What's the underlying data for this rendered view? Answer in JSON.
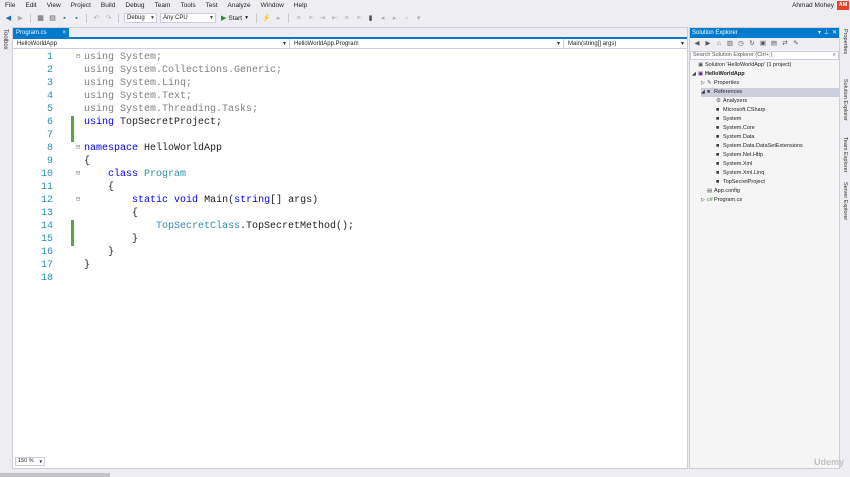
{
  "menu": {
    "items": [
      "File",
      "Edit",
      "View",
      "Project",
      "Build",
      "Debug",
      "Team",
      "Tools",
      "Test",
      "Analyze",
      "Window",
      "Help"
    ],
    "user_name": "Ahmad Mohey",
    "avatar_initials": "AM"
  },
  "toolbar": {
    "configuration": "Debug",
    "platform": "Any CPU",
    "start_label": "Start"
  },
  "toolbox": {
    "label": "Toolbox"
  },
  "editor": {
    "tab_label": "Program.cs",
    "tab_close": "×",
    "nav_project": "HelloWorldApp",
    "nav_type": "HelloWorldApp.Program",
    "nav_member": "Main(string[] args)",
    "zoom": "150 %",
    "line_numbers": [
      "1",
      "2",
      "3",
      "4",
      "5",
      "6",
      "7",
      "8",
      "9",
      "10",
      "11",
      "12",
      "13",
      "14",
      "15",
      "16",
      "17",
      "18"
    ],
    "lines": [
      {
        "indent": "",
        "parts": [
          [
            "kw-dim",
            "using"
          ],
          [
            "gray",
            " System;"
          ]
        ]
      },
      {
        "indent": "",
        "parts": [
          [
            "kw-dim",
            "using"
          ],
          [
            "gray",
            " System.Collections.Generic;"
          ]
        ]
      },
      {
        "indent": "",
        "parts": [
          [
            "kw-dim",
            "using"
          ],
          [
            "gray",
            " System.Linq;"
          ]
        ]
      },
      {
        "indent": "",
        "parts": [
          [
            "kw-dim",
            "using"
          ],
          [
            "gray",
            " System.Text;"
          ]
        ]
      },
      {
        "indent": "",
        "parts": [
          [
            "kw-dim",
            "using"
          ],
          [
            "gray",
            " System.Threading.Tasks;"
          ]
        ]
      },
      {
        "indent": "",
        "parts": [
          [
            "kw",
            "using"
          ],
          [
            "plain",
            " TopSecretProject;"
          ]
        ]
      },
      {
        "indent": "",
        "parts": []
      },
      {
        "indent": "",
        "parts": [
          [
            "kw",
            "namespace"
          ],
          [
            "plain",
            " HelloWorldApp"
          ]
        ]
      },
      {
        "indent": "",
        "parts": [
          [
            "plain",
            "{"
          ]
        ]
      },
      {
        "indent": "    ",
        "parts": [
          [
            "kw",
            "class"
          ],
          [
            "plain",
            " "
          ],
          [
            "cls",
            "Program"
          ]
        ]
      },
      {
        "indent": "    ",
        "parts": [
          [
            "plain",
            "{"
          ]
        ]
      },
      {
        "indent": "        ",
        "parts": [
          [
            "kw",
            "static"
          ],
          [
            "plain",
            " "
          ],
          [
            "kw",
            "void"
          ],
          [
            "plain",
            " Main("
          ],
          [
            "kw",
            "string"
          ],
          [
            "plain",
            "[] args)"
          ]
        ]
      },
      {
        "indent": "        ",
        "parts": [
          [
            "plain",
            "{"
          ]
        ]
      },
      {
        "indent": "            ",
        "parts": [
          [
            "cls",
            "TopSecretClass"
          ],
          [
            "plain",
            ".TopSecretMethod();"
          ]
        ]
      },
      {
        "indent": "        ",
        "parts": [
          [
            "plain",
            "}"
          ]
        ]
      },
      {
        "indent": "    ",
        "parts": [
          [
            "plain",
            "}"
          ]
        ]
      },
      {
        "indent": "",
        "parts": [
          [
            "plain",
            "}"
          ]
        ]
      },
      {
        "indent": "",
        "parts": []
      }
    ],
    "changed_lines": [
      5,
      6,
      13,
      14
    ]
  },
  "solution_explorer": {
    "title": "Solution Explorer",
    "search_placeholder": "Search Solution Explorer (Ctrl+;)",
    "tree": [
      {
        "level": 0,
        "expander": "",
        "icon": "solution-icon",
        "glyph": "▣",
        "label": "Solution 'HelloWorldApp' (1 project)",
        "bold": false
      },
      {
        "level": 0,
        "expander": "◢",
        "icon": "csharp-project-icon",
        "glyph": "▣",
        "label": "HelloWorldApp",
        "bold": true
      },
      {
        "level": 1,
        "expander": "▷",
        "icon": "wrench-icon",
        "glyph": "✎",
        "label": "Properties",
        "bold": false
      },
      {
        "level": 1,
        "expander": "◢",
        "icon": "references-icon",
        "glyph": "■",
        "label": "References",
        "bold": false,
        "selected": true
      },
      {
        "level": 2,
        "expander": "",
        "icon": "analyzers-icon",
        "glyph": "⚙",
        "label": "Analyzers",
        "bold": false
      },
      {
        "level": 2,
        "expander": "",
        "icon": "reference-icon",
        "glyph": "■",
        "label": "Microsoft.CSharp",
        "bold": false
      },
      {
        "level": 2,
        "expander": "",
        "icon": "reference-icon",
        "glyph": "■",
        "label": "System",
        "bold": false
      },
      {
        "level": 2,
        "expander": "",
        "icon": "reference-icon",
        "glyph": "■",
        "label": "System.Core",
        "bold": false
      },
      {
        "level": 2,
        "expander": "",
        "icon": "reference-icon",
        "glyph": "■",
        "label": "System.Data",
        "bold": false
      },
      {
        "level": 2,
        "expander": "",
        "icon": "reference-icon",
        "glyph": "■",
        "label": "System.Data.DataSetExtensions",
        "bold": false
      },
      {
        "level": 2,
        "expander": "",
        "icon": "reference-icon",
        "glyph": "■",
        "label": "System.Net.Http",
        "bold": false
      },
      {
        "level": 2,
        "expander": "",
        "icon": "reference-icon",
        "glyph": "■",
        "label": "System.Xml",
        "bold": false
      },
      {
        "level": 2,
        "expander": "",
        "icon": "reference-icon",
        "glyph": "■",
        "label": "System.Xml.Linq",
        "bold": false
      },
      {
        "level": 2,
        "expander": "",
        "icon": "reference-icon",
        "glyph": "■",
        "label": "TopSecretProject",
        "bold": false
      },
      {
        "level": 1,
        "expander": "",
        "icon": "config-icon",
        "glyph": "▤",
        "label": "App.config",
        "bold": false
      },
      {
        "level": 1,
        "expander": "▷",
        "icon": "csharp-file-icon",
        "glyph": "c#",
        "label": "Program.cs",
        "bold": false
      }
    ]
  },
  "right_tabs": [
    "Properties",
    "Solution Explorer",
    "Team Explorer",
    "Server Explorer"
  ],
  "watermark": "Udemy",
  "colors": {
    "accent": "#007acc",
    "keyword": "#0000ff",
    "type": "#2b91af",
    "changed": "#57a64a"
  }
}
